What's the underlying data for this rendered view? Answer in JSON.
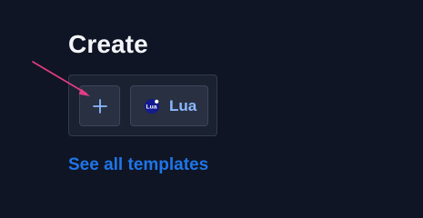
{
  "header": {
    "title": "Create"
  },
  "templates": {
    "items": [
      {
        "icon": "plus-icon",
        "label": ""
      },
      {
        "icon": "lua-logo-icon",
        "label": "Lua",
        "logo_text": "Lua"
      }
    ]
  },
  "footer": {
    "see_all_label": "See all templates"
  },
  "colors": {
    "background": "#0f1524",
    "panel": "#1a2130",
    "tile": "#283042",
    "accent": "#1f75e8",
    "tile_text": "#8db8ff",
    "annotation_arrow": "#e73b84"
  }
}
